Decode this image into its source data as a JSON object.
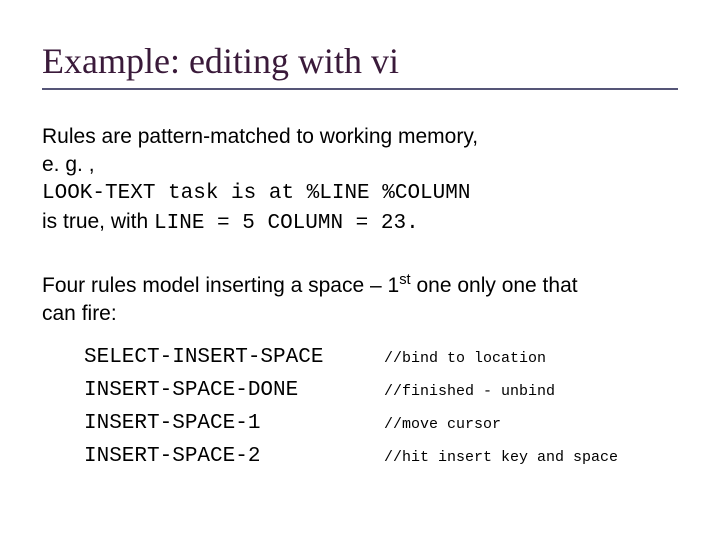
{
  "title": "Example: editing with vi",
  "line1": "Rules are pattern-matched to working memory,",
  "line2": "e. g. ,",
  "line3": "LOOK-TEXT task is at %LINE %COLUMN",
  "line4_pre": "is true, with ",
  "line4_mono": "LINE = 5 COLUMN = 23.",
  "line5_pre": "Four rules model inserting a space – 1",
  "line5_sup": "st",
  "line5_post": " one only one that",
  "line6": "can fire:",
  "rules": [
    {
      "name": "SELECT-INSERT-SPACE",
      "comment": "//bind to location"
    },
    {
      "name": "INSERT-SPACE-DONE",
      "comment": "//finished - unbind"
    },
    {
      "name": "INSERT-SPACE-1",
      "comment": "//move cursor"
    },
    {
      "name": "INSERT-SPACE-2",
      "comment": "//hit insert key and space"
    }
  ]
}
